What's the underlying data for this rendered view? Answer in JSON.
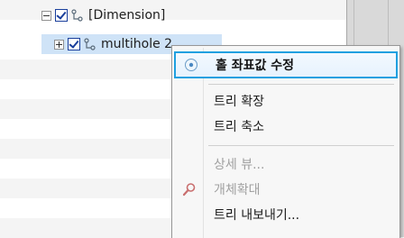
{
  "tree": {
    "nodes": [
      {
        "label": "[Dimension]",
        "expander": "minus",
        "checked": true
      },
      {
        "label": "multihole 2",
        "expander": "plus",
        "checked": true,
        "selected": true
      }
    ]
  },
  "menu": {
    "items": [
      {
        "label": "홀 좌표값 수정",
        "icon": "radio-icon",
        "enabled": true,
        "highlighted": true
      },
      {
        "label": "트리 확장",
        "enabled": true
      },
      {
        "label": "트리 축소",
        "enabled": true
      },
      {
        "label": "상세 뷰...",
        "enabled": false
      },
      {
        "label": "개체확대",
        "icon": "magnifier-icon",
        "enabled": false
      },
      {
        "label": "트리 내보내기...",
        "enabled": true
      }
    ]
  },
  "colors": {
    "highlight_border": "#1fa0e0",
    "selection": "#cfe3f7",
    "checkbox": "#1a3f9c",
    "disabled_text": "#a0a0a0"
  }
}
